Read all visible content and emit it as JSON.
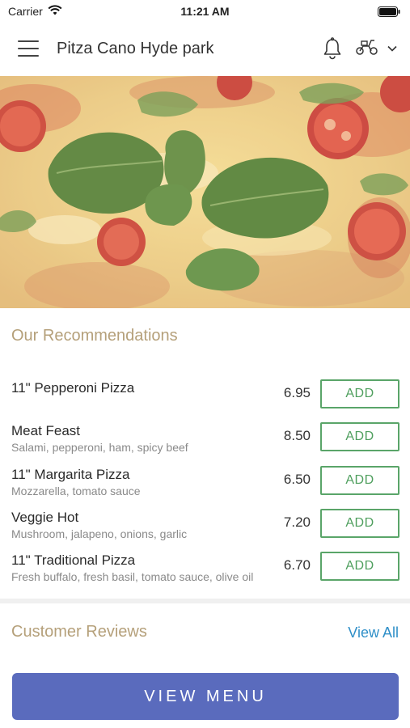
{
  "status_bar": {
    "carrier": "Carrier",
    "time": "11:21 AM",
    "icons": [
      "wifi-icon",
      "battery-icon"
    ]
  },
  "header": {
    "title": "Pitza Cano Hyde park",
    "icons": [
      "menu-icon",
      "bell-icon",
      "scooter-icon",
      "chevron-down-icon"
    ]
  },
  "hero": {
    "image": "pizza-photo"
  },
  "recommendations": {
    "title": "Our Recommendations",
    "items": [
      {
        "name": "11\" Pepperoni Pizza",
        "description": "",
        "price": "6.95",
        "action": "ADD"
      },
      {
        "name": "Meat Feast",
        "description": "Salami, pepperoni, ham, spicy beef",
        "price": "8.50",
        "action": "ADD"
      },
      {
        "name": "11\" Margarita Pizza",
        "description": "Mozzarella, tomato sauce",
        "price": "6.50",
        "action": "ADD"
      },
      {
        "name": "Veggie Hot",
        "description": "Mushroom, jalapeno, onions, garlic",
        "price": "7.20",
        "action": "ADD"
      },
      {
        "name": "11\" Traditional Pizza",
        "description": "Fresh buffalo, fresh basil, tomato sauce, olive oil",
        "price": "6.70",
        "action": "ADD"
      }
    ]
  },
  "reviews": {
    "title": "Customer Reviews",
    "view_all": "View All"
  },
  "footer": {
    "view_menu": "VIEW MENU"
  },
  "colors": {
    "section_title": "#b5a07a",
    "add_button": "#5aa569",
    "link": "#2f8fc8",
    "primary_button": "#5a6bbd"
  }
}
